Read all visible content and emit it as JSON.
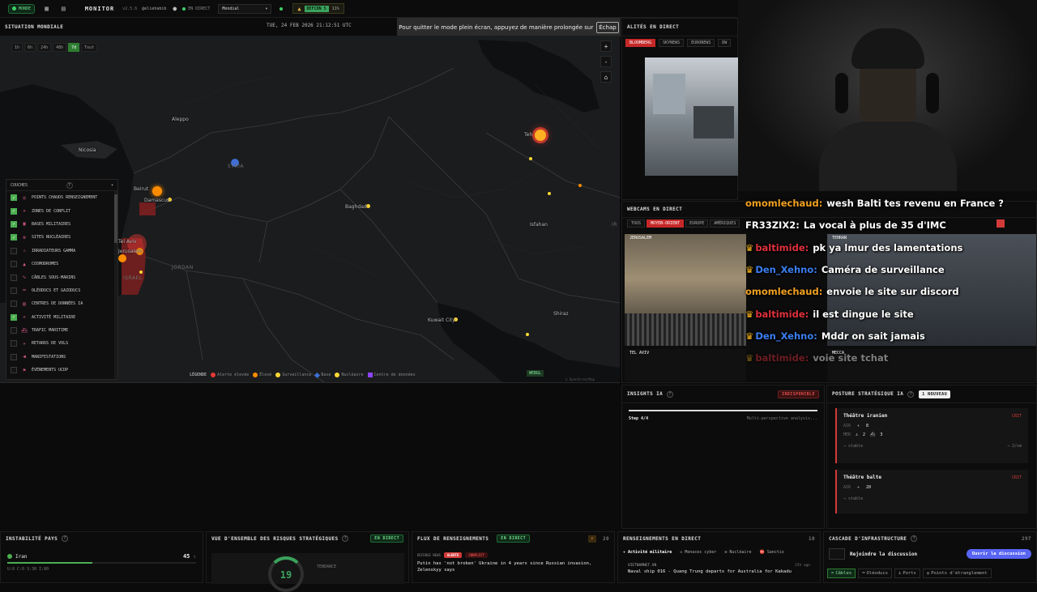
{
  "topbar": {
    "live_badge": "MONDE",
    "app_title": "MONITOR",
    "version": "v2.5.6",
    "handle": "@eliehabib",
    "live_label": "EN DIRECT",
    "region_select": "Mondial",
    "defcon_label": "DEFCON 5",
    "defcon_pct": "11%"
  },
  "fullscreen_notice": {
    "text": "Pour quitter le mode plein écran, appuyez de manière prolongée sur",
    "key": "Échap"
  },
  "map": {
    "title": "SITUATION MONDIALE",
    "datetime": "TUE, 24 FEB 2026 21:12:51 UTC",
    "time_buttons": [
      "1h",
      "6h",
      "24h",
      "48h",
      "7d",
      "Tout"
    ],
    "active_time": "7d",
    "cities": {
      "aleppo": "Aleppo",
      "nicosia": "Nicosia",
      "beirut": "Beirut",
      "damascus": "Damascus",
      "baghdad": "Baghdad",
      "tehran": "Teh",
      "isfahan": "Isfahan",
      "kuwait": "Kuwait City",
      "shiraz": "Shiraz",
      "telaviv": "Tel Aviv",
      "jerusalem": "Jerusalem"
    },
    "countries": {
      "syria": "SYRIA",
      "jordan": "JORDAN",
      "israel": "ISRAEL",
      "iran": "IR"
    },
    "zoom": {
      "plus": "+",
      "minus": "-",
      "home": "⌂"
    },
    "legend": {
      "title": "LÉGENDE",
      "items": [
        {
          "label": "Alerte élevée",
          "color": "#e53935"
        },
        {
          "label": "Élevé",
          "color": "#fb8c00"
        },
        {
          "label": "Surveillance",
          "color": "#fdd835"
        },
        {
          "label": "Base",
          "color": "#3f6fd6"
        },
        {
          "label": "Nucléaire",
          "color": "#fdd835"
        },
        {
          "label": "Centre de données",
          "color": "#8e44ff"
        }
      ]
    },
    "webgl_badge": "WEBGL",
    "attribution": "© OpenStreetMap"
  },
  "layers": {
    "title": "COUCHES",
    "help": "?",
    "items": [
      {
        "label": "POINTS CHAUDS RENSEIGNEMENT",
        "checked": true,
        "icon": "target-icon"
      },
      {
        "label": "ZONES DE CONFLIT",
        "checked": true,
        "icon": "swords-icon"
      },
      {
        "label": "BASES MILITAIRES",
        "checked": true,
        "icon": "building-icon"
      },
      {
        "label": "SITES NUCLÉAIRES",
        "checked": true,
        "icon": "radiation-icon"
      },
      {
        "label": "IRRADIATEURS GAMMA",
        "checked": false,
        "icon": "warning-icon"
      },
      {
        "label": "COSMODROMES",
        "checked": false,
        "icon": "rocket-icon"
      },
      {
        "label": "CÂBLES SOUS-MARINS",
        "checked": false,
        "icon": "cable-icon"
      },
      {
        "label": "OLÉODUCS ET GAZODUCS",
        "checked": false,
        "icon": "pipeline-icon"
      },
      {
        "label": "CENTRES DE DONNÉES IA",
        "checked": false,
        "icon": "server-icon"
      },
      {
        "label": "ACTIVITÉ MILITAIRE",
        "checked": true,
        "icon": "plane-icon"
      },
      {
        "label": "TRAFIC MARITIME",
        "checked": false,
        "icon": "ship-icon"
      },
      {
        "label": "RETARDS DE VOLS",
        "checked": false,
        "icon": "plane-icon"
      },
      {
        "label": "MANIFESTATIONS",
        "checked": false,
        "icon": "megaphone-icon"
      },
      {
        "label": "ÉVÉNEMENTS UCDP",
        "checked": false,
        "icon": "flag-icon"
      }
    ]
  },
  "live_news": {
    "title": "ALITÉS EN DIRECT",
    "channels": [
      "BLOOMBERG",
      "SKYNEWS",
      "EURONEWS",
      "DW"
    ]
  },
  "webcams": {
    "title": "WEBCAMS EN DIRECT",
    "filters": [
      "TOUS",
      "MOYEN-ORIENT",
      "EUROPE",
      "AMÉRIQUES"
    ],
    "active": "MOYEN-ORIENT",
    "cams": [
      "JERUSALEM",
      "TEHRAN",
      "TEL AVIV",
      "MECCA"
    ]
  },
  "chat": [
    {
      "user": "omomlechaud:",
      "msg": "wesh Balti tes revenu en France ?",
      "color": "#f0a020",
      "crown": false
    },
    {
      "user": "FR33ZIX2:",
      "msg": "La vocal à plus de 35 d'IMC",
      "color": "#ffffff",
      "crown": false
    },
    {
      "user": "baltimide:",
      "msg": "pk ya lmur des lamentations",
      "color": "#e0303c",
      "crown": true
    },
    {
      "user": "Den_Xehno:",
      "msg": "Caméra de surveillance",
      "color": "#3a7ef0",
      "crown": true
    },
    {
      "user": "omomlechaud:",
      "msg": "envoie le site sur discord",
      "color": "#f0a020",
      "crown": false
    },
    {
      "user": "baltimide:",
      "msg": "il est dingue le site",
      "color": "#e0303c",
      "crown": true
    },
    {
      "user": "Den_Xehno:",
      "msg": "Mddr on sait jamais",
      "color": "#3a7ef0",
      "crown": true
    },
    {
      "user": "baltimide:",
      "msg": "voie site tchat",
      "color": "#e0303c",
      "crown": true
    }
  ],
  "insights": {
    "title": "INSIGHTS IA",
    "badge": "INDISPONIBLE",
    "step": "Step 4/4",
    "status": "Multi-perspective analysis..."
  },
  "posture": {
    "title": "POSTURE STRATÉGIQUE IA",
    "badge": "1 NOUVEAU",
    "cards": [
      {
        "name": "Théâtre iranien",
        "level": "CRIT",
        "air_label": "AIR",
        "air": "8",
        "sea_label": "MER",
        "sea1": "2",
        "sea2": "3",
        "trend": "→ stable",
        "extra": "→ 2/sm"
      },
      {
        "name": "Théâtre balte",
        "level": "CRIT",
        "air_label": "AIR",
        "air": "20",
        "trend": "→ stable"
      }
    ]
  },
  "bottom": {
    "instability": {
      "title": "INSTABILITÉ PAYS",
      "country": "Iran",
      "score": "45",
      "stats": "U:0  C:0  S:30  I:80"
    },
    "risk": {
      "title": "VUE D'ENSEMBLE DES RISQUES STRATÉGIQUES",
      "badge": "EN DIRECT",
      "score": "19",
      "trend": "TENDANCE"
    },
    "intel_feed": {
      "title": "FLUX DE RENSEIGNEMENTS",
      "badge": "EN DIRECT",
      "count": "20",
      "source": "DEFENSE NEWS",
      "alert": "ALERTE",
      "tag": "CONFLICT",
      "headline": "Putin has 'not broken' Ukraine in 4 years since Russian invasion, Zelenskyy says"
    },
    "live_intel": {
      "title": "RENSEIGNEMENTS EN DIRECT",
      "count": "10",
      "tabs": [
        "Activité militaire",
        "Menaces cyber",
        "Nucléaire",
        "Sanctio"
      ],
      "source": "VIETNAMNET.VN",
      "time": "15h ago",
      "headline": "Naval ship 016 - Quang Trung departs for Australia for Kakadu"
    },
    "cascade": {
      "title": "CASCADE D'INFRASTRUCTURE",
      "count": "297",
      "join_text": "Rejoindre la discussion",
      "join_button": "Ouvrir la discussion",
      "tabs": [
        "Câbles",
        "Oléoducs",
        "Ports",
        "Points d'étranglement"
      ]
    }
  }
}
